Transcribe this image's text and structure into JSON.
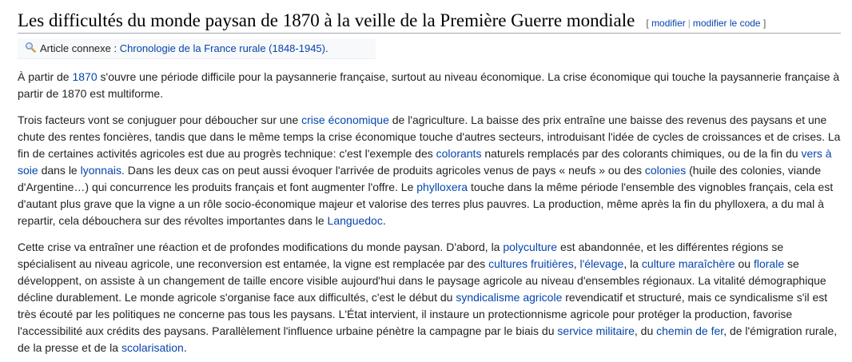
{
  "heading": {
    "title": "Les difficultés du monde paysan de 1870 à la veille de la Première Guerre mondiale",
    "bracket_open": "[",
    "edit": "modifier",
    "separator": "|",
    "edit_source": "modifier le code",
    "bracket_close": "]"
  },
  "hatnote": {
    "icon": "magnifier-icon",
    "prefix": "Article connexe : ",
    "link": "Chronologie de la France rurale (1848-1945)",
    "suffix": "."
  },
  "p1": {
    "t0": "À partir de ",
    "l0": "1870",
    "t1": " s'ouvre une période difficile pour la paysannerie française, surtout au niveau économique. La crise économique qui touche la paysannerie française à partir de 1870 est multiforme."
  },
  "p2": {
    "t0": "Trois facteurs vont se conjuguer pour déboucher sur une ",
    "l0": "crise économique",
    "t1": " de l'agriculture. La baisse des prix entraîne une baisse des revenus des paysans et une chute des rentes foncières, tandis que dans le même temps la crise économique touche d'autres secteurs, introduisant l'idée de cycles de croissances et de crises. La fin de certaines activités agricoles est due au progrès technique: c'est l'exemple des ",
    "l1": "colorants",
    "t2": " naturels remplacés par des colorants chimiques, ou de la fin du ",
    "l2": "vers à soie",
    "t3": " dans le ",
    "l3": "lyonnais",
    "t4": ". Dans les deux cas on peut aussi évoquer l'arrivée de produits agricoles venus de pays « neufs » ou des ",
    "l4": "colonies",
    "t5": " (huile des colonies, viande d'Argentine…) qui concurrence les produits français et font augmenter l'offre. Le ",
    "l5": "phylloxera",
    "t6": " touche dans la même période l'ensemble des vignobles français, cela est d'autant plus grave que la vigne a un rôle socio-économique majeur et valorise des terres plus pauvres. La production, même après la fin du phylloxera, a du mal à repartir, cela débouchera sur des révoltes importantes dans le ",
    "l6": "Languedoc",
    "t7": "."
  },
  "p3": {
    "t0": "Cette crise va entraîner une réaction et de profondes modifications du monde paysan. D'abord, la ",
    "l0": "polyculture",
    "t1": " est abandonnée, et les différentes régions se spécialisent au niveau agricole, une reconversion est entamée, la vigne est remplacée par des ",
    "l1": "cultures fruitières",
    "t2": ", ",
    "l2": "l'élevage",
    "t3": ", la ",
    "l3": "culture maraîchère",
    "t4": " ou ",
    "l4": "florale",
    "t5": " se développent, on assiste à un changement de taille encore visible aujourd'hui dans le paysage agricole au niveau d'ensembles régionaux. La vitalité démographique décline durablement. Le monde agricole s'organise face aux difficultés, c'est le début du ",
    "l5": "syndicalisme agricole",
    "t6": " revendicatif et structuré, mais ce syndicalisme s'il est très écouté par les politiques ne concerne pas tous les paysans. L'État intervient, il instaure un protectionnisme agricole pour protéger la production, favorise l'accessibilité aux crédits des paysans. Parallèlement l'influence urbaine pénètre la campagne par le biais du ",
    "l6": "service militaire",
    "t7": ", du ",
    "l7": "chemin de fer",
    "t8": ", de l'émigration rurale, de la presse et de la ",
    "l8": "scolarisation",
    "t9": "."
  },
  "colors": {
    "link": "#0645ad",
    "text": "#222222",
    "rule": "#a2a9b1",
    "hatnote_bg": "#f8f9fa"
  }
}
